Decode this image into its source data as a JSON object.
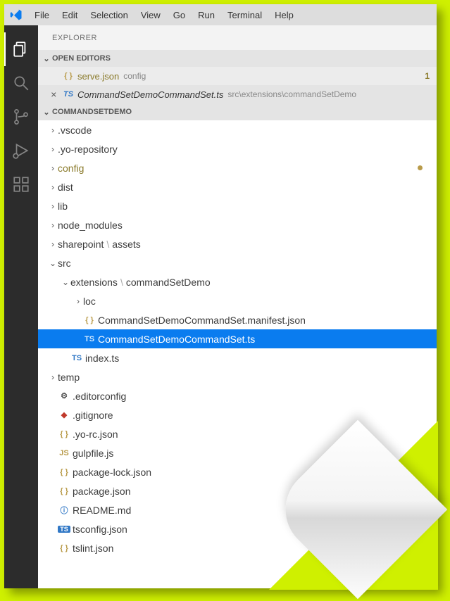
{
  "menu": {
    "items": [
      "File",
      "Edit",
      "Selection",
      "View",
      "Go",
      "Run",
      "Terminal",
      "Help"
    ]
  },
  "sidebar": {
    "title": "Explorer"
  },
  "sections": {
    "openEditors": "Open Editors",
    "project": "CommandSetDemo"
  },
  "openEditors": {
    "items": [
      {
        "name": "serve.json",
        "path": "config",
        "icon": "{ }",
        "iconClass": "ic-json",
        "modified": true,
        "badge": "1",
        "close": ""
      },
      {
        "name": "CommandSetDemoCommandSet.ts",
        "path": "src\\extensions\\commandSetDemo",
        "icon": "TS",
        "iconClass": "ic-ts",
        "modified": false,
        "active": true,
        "close": "×"
      }
    ]
  },
  "tree": [
    {
      "d": 0,
      "t": "folder",
      "c": "closed",
      "label": ".vscode"
    },
    {
      "d": 0,
      "t": "folder",
      "c": "closed",
      "label": ".yo-repository"
    },
    {
      "d": 0,
      "t": "folder",
      "c": "closed",
      "label": "config",
      "modified": true,
      "dot": true
    },
    {
      "d": 0,
      "t": "folder",
      "c": "closed",
      "label": "dist"
    },
    {
      "d": 0,
      "t": "folder",
      "c": "closed",
      "label": "lib"
    },
    {
      "d": 0,
      "t": "folder",
      "c": "closed",
      "label": "node_modules"
    },
    {
      "d": 0,
      "t": "folder",
      "c": "closed",
      "label": "sharepoint",
      "sub": "assets"
    },
    {
      "d": 0,
      "t": "folder",
      "c": "open",
      "label": "src"
    },
    {
      "d": 1,
      "t": "folder",
      "c": "open",
      "label": "extensions",
      "sub": "commandSetDemo"
    },
    {
      "d": 2,
      "t": "folder",
      "c": "closed",
      "label": "loc"
    },
    {
      "d": 2,
      "t": "file",
      "icon": "{ }",
      "iconClass": "ic-json",
      "label": "CommandSetDemoCommandSet.manifest.json"
    },
    {
      "d": 2,
      "t": "file",
      "icon": "TS",
      "iconClass": "ic-ts",
      "label": "CommandSetDemoCommandSet.ts",
      "selected": true
    },
    {
      "d": 1,
      "t": "file",
      "icon": "TS",
      "iconClass": "ic-ts",
      "label": "index.ts"
    },
    {
      "d": 0,
      "t": "folder",
      "c": "closed",
      "label": "temp"
    },
    {
      "d": 0,
      "t": "file",
      "icon": "⚙",
      "iconClass": "ic-gear",
      "label": ".editorconfig"
    },
    {
      "d": 0,
      "t": "file",
      "icon": "◆",
      "iconClass": "ic-git",
      "label": ".gitignore"
    },
    {
      "d": 0,
      "t": "file",
      "icon": "{ }",
      "iconClass": "ic-json",
      "label": ".yo-rc.json"
    },
    {
      "d": 0,
      "t": "file",
      "icon": "JS",
      "iconClass": "ic-js",
      "label": "gulpfile.js"
    },
    {
      "d": 0,
      "t": "file",
      "icon": "{ }",
      "iconClass": "ic-json",
      "label": "package-lock.json"
    },
    {
      "d": 0,
      "t": "file",
      "icon": "{ }",
      "iconClass": "ic-json",
      "label": "package.json"
    },
    {
      "d": 0,
      "t": "file",
      "icon": "ⓘ",
      "iconClass": "ic-info",
      "label": "README.md"
    },
    {
      "d": 0,
      "t": "file",
      "icon": "TS",
      "iconClass": "ic-tsconf",
      "label": "tsconfig.json",
      "iconBox": true
    },
    {
      "d": 0,
      "t": "file",
      "icon": "{ }",
      "iconClass": "ic-json",
      "label": "tslint.json"
    }
  ]
}
